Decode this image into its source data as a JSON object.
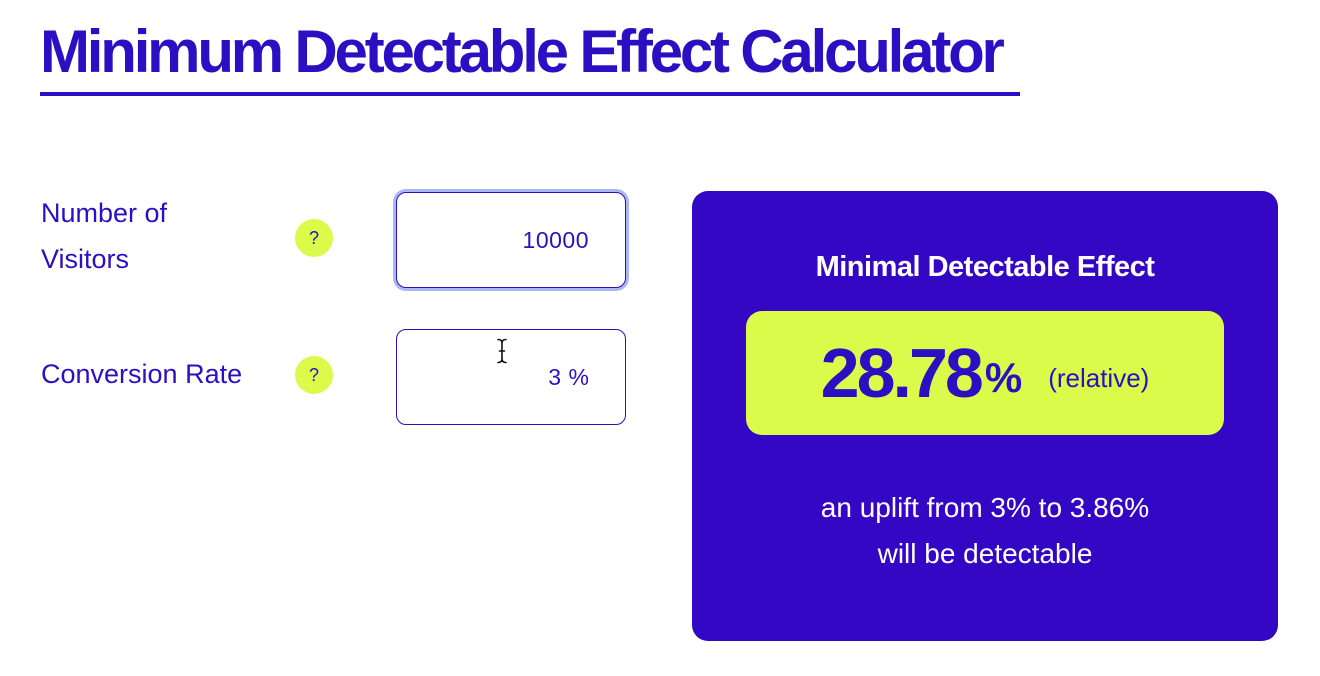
{
  "page": {
    "title": "Minimum Detectable Effect Calculator"
  },
  "form": {
    "visitors": {
      "label": "Number of Visitors",
      "help": "?",
      "value": "10000"
    },
    "conversion_rate": {
      "label": "Conversion Rate",
      "help": "?",
      "value": "3",
      "unit": "%"
    }
  },
  "result": {
    "title": "Minimal Detectable Effect",
    "value": "28.78",
    "unit": "%",
    "qualifier": "(relative)",
    "description_line1": "an uplift from 3% to 3.86%",
    "description_line2": "will be detectable"
  },
  "colors": {
    "primary": "#2c0fc2",
    "card_background": "#3307c4",
    "accent": "#dcfa4a",
    "background": "#ffffff",
    "focus_ring": "#a9b7f2"
  },
  "icons": {
    "help": "question-mark-icon",
    "cursor": "text-cursor-icon"
  }
}
